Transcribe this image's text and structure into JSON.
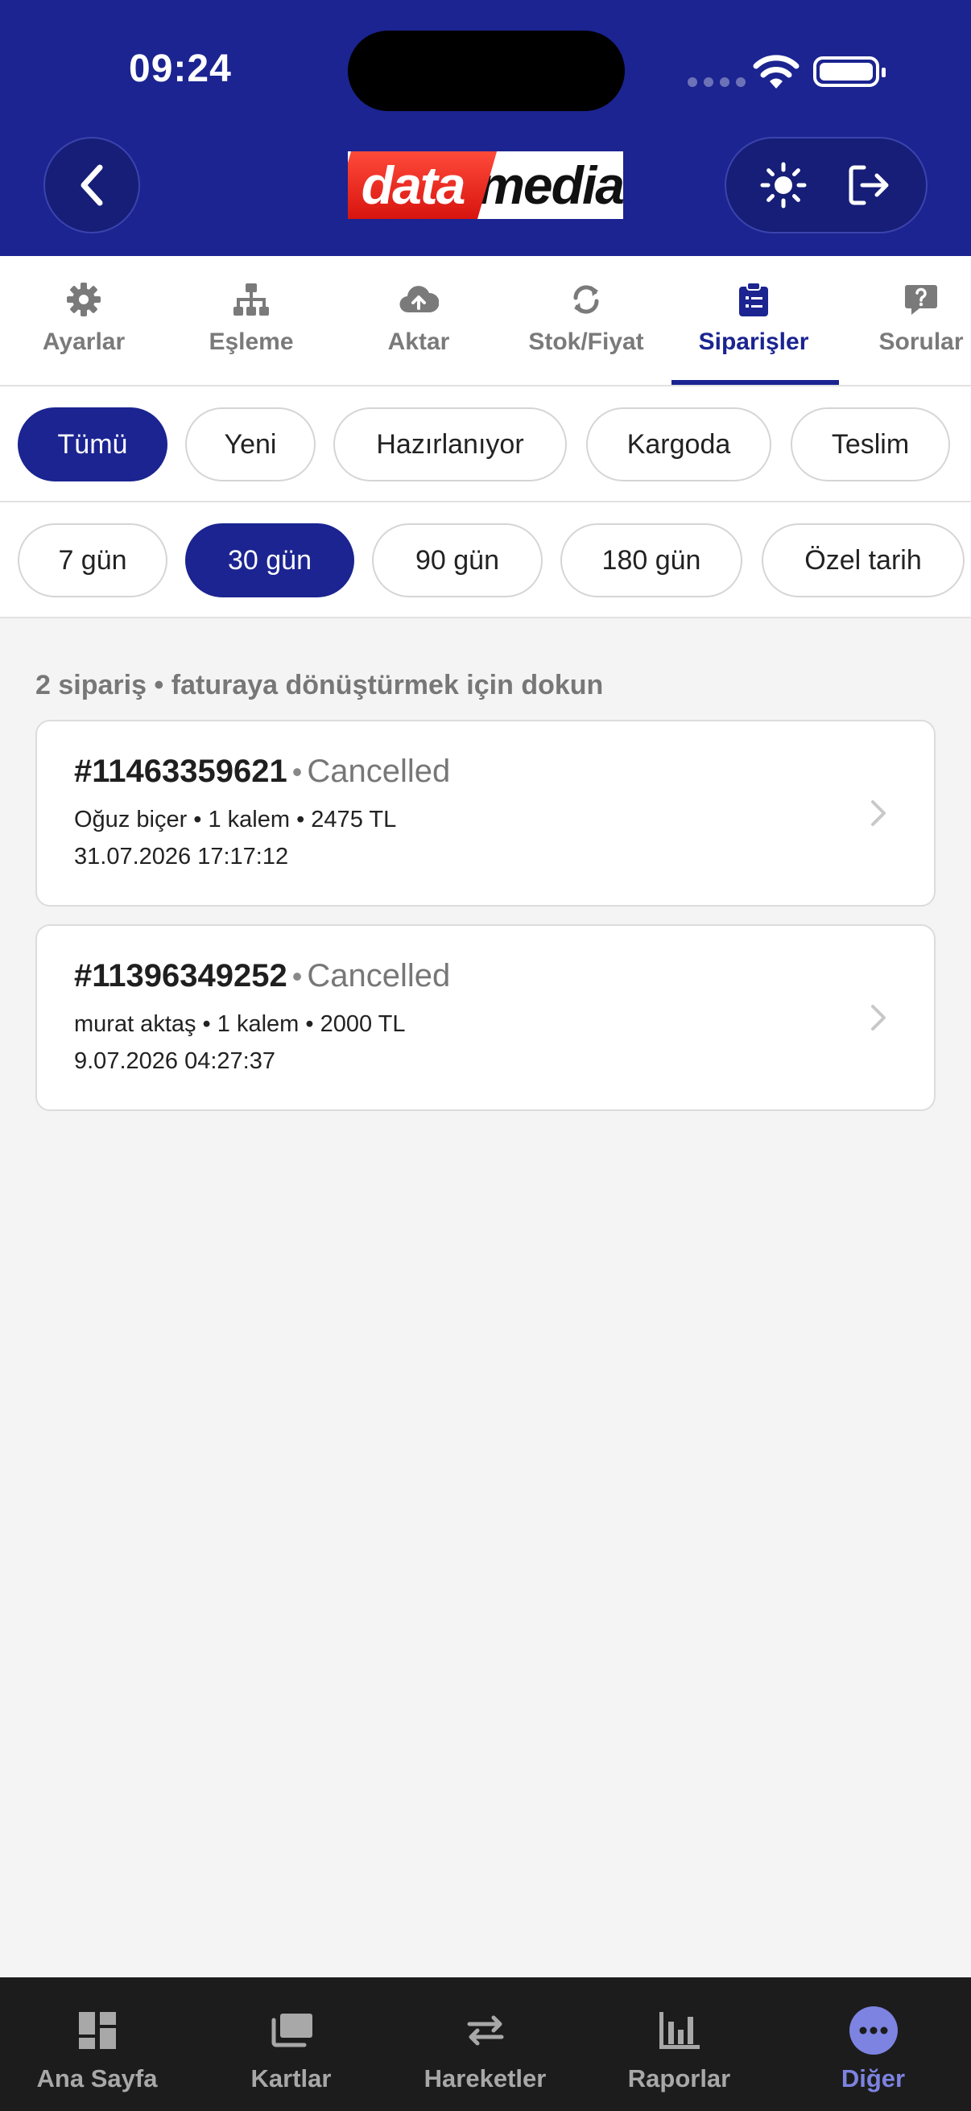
{
  "status_bar": {
    "time": "09:24"
  },
  "header": {
    "logo_left": "data",
    "logo_right": "media"
  },
  "tabs": [
    {
      "label": "Ayarlar",
      "icon": "gear-icon"
    },
    {
      "label": "Eşleme",
      "icon": "sitemap-icon"
    },
    {
      "label": "Aktar",
      "icon": "cloud-upload-icon"
    },
    {
      "label": "Stok/Fiyat",
      "icon": "sync-icon"
    },
    {
      "label": "Siparişler",
      "icon": "clipboard-list-icon",
      "active": true
    },
    {
      "label": "Sorular",
      "icon": "question-comment-icon"
    }
  ],
  "status_filters": [
    {
      "label": "Tümü",
      "active": true
    },
    {
      "label": "Yeni"
    },
    {
      "label": "Hazırlanıyor"
    },
    {
      "label": "Kargoda"
    },
    {
      "label": "Teslim"
    }
  ],
  "period_filters": [
    {
      "label": "7 gün"
    },
    {
      "label": "30 gün",
      "active": true
    },
    {
      "label": "90 gün"
    },
    {
      "label": "180 gün"
    },
    {
      "label": "Özel tarih"
    }
  ],
  "summary": "2 sipariş • faturaya dönüştürmek için dokun",
  "orders": [
    {
      "number": "#11463359621",
      "status": "Cancelled",
      "details": "Oğuz biçer • 1 kalem • 2475 TL",
      "date": "31.07.2026 17:17:12"
    },
    {
      "number": "#11396349252",
      "status": "Cancelled",
      "details": "murat aktaş • 1 kalem • 2000 TL",
      "date": "9.07.2026 04:27:37"
    }
  ],
  "bottom_nav": [
    {
      "label": "Ana Sayfa",
      "icon": "dashboard-icon"
    },
    {
      "label": "Kartlar",
      "icon": "cards-icon"
    },
    {
      "label": "Hareketler",
      "icon": "swap-arrows-icon"
    },
    {
      "label": "Raporlar",
      "icon": "bar-chart-icon"
    },
    {
      "label": "Diğer",
      "icon": "more-dots-icon",
      "active": true
    }
  ],
  "colors": {
    "primary": "#1b2490",
    "nav_active": "#7d83e0",
    "background": "#f4f4f4"
  }
}
